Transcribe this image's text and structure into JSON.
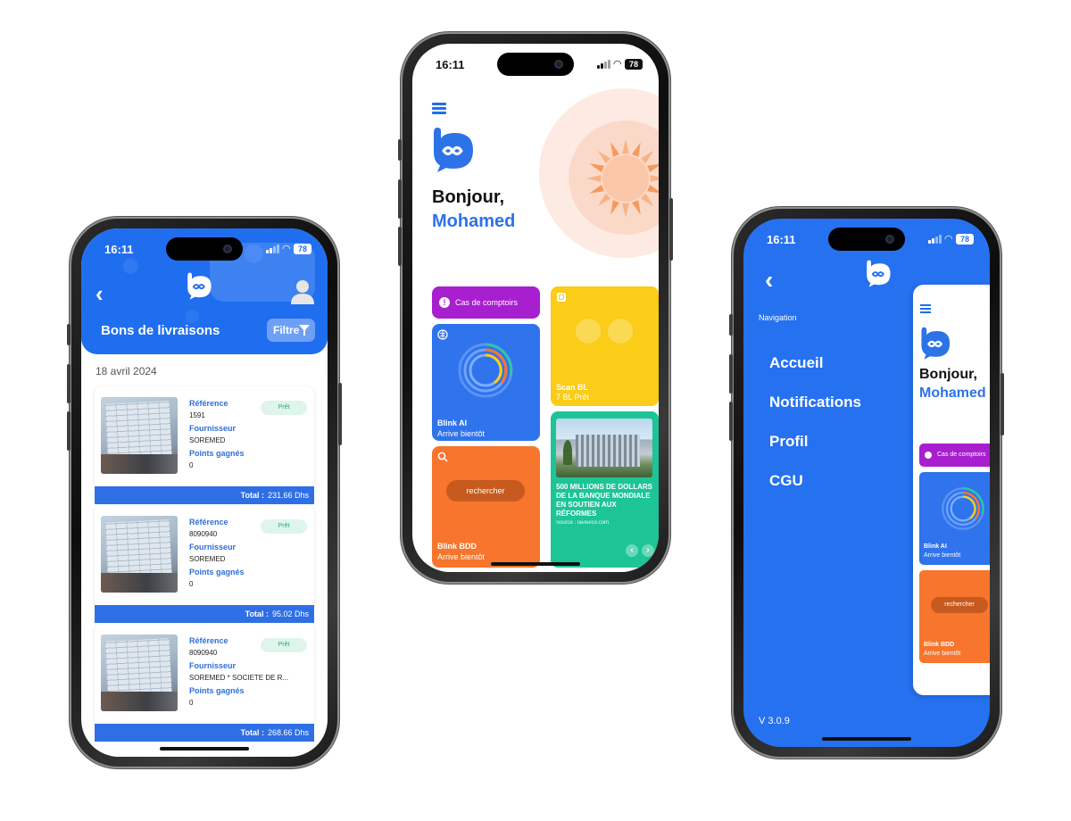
{
  "status": {
    "time": "16:11",
    "battery": "78"
  },
  "colors": {
    "primary": "#1f6ef0",
    "purple": "#a81fcf",
    "orange": "#f7752d",
    "yellow": "#fbcc18",
    "green": "#1dc496"
  },
  "deliveries": {
    "title": "Bons de livraisons",
    "filter_label": "Filtre",
    "date": "18 avril 2024",
    "labels": {
      "reference": "Référence",
      "supplier": "Fournisseur",
      "points": "Points gagnés",
      "total": "Total :"
    },
    "items": [
      {
        "reference": "1591",
        "supplier": "SOREMED",
        "points": "0",
        "status": "Prêt",
        "total": "231.66 Dhs"
      },
      {
        "reference": "8090940",
        "supplier": "SOREMED",
        "points": "0",
        "status": "Prêt",
        "total": "95.02 Dhs"
      },
      {
        "reference": "8090940",
        "supplier": "SOREMED * SOCIETE DE R...",
        "points": "0",
        "status": "Prêt",
        "total": "268.66 Dhs"
      }
    ]
  },
  "home": {
    "greeting": "Bonjour,",
    "user_name": "Mohamed",
    "tiles": {
      "cas": {
        "label": "Cas de comptoirs"
      },
      "ai": {
        "title": "Blink AI",
        "subtitle": "Arrive bientôt"
      },
      "bdd": {
        "title": "Blink BDD",
        "subtitle": "Arrive bientôt",
        "button": "rechercher"
      },
      "scan": {
        "title": "Scan BL",
        "subtitle": "7 BL Prêt"
      },
      "news": {
        "headline": "500 MILLIONS DE DOLLARS DE LA BANQUE MONDIALE EN SOUTIEN AUX RÉFORMES",
        "source": "Source : lavieeco.com",
        "prev": "‹",
        "next": "›"
      }
    }
  },
  "menu": {
    "nav_label": "Navigation",
    "items": [
      {
        "label": "Accueil"
      },
      {
        "label": "Notifications"
      },
      {
        "label": "Profil"
      },
      {
        "label": "CGU"
      }
    ],
    "version": "V 3.0.9",
    "preview": {
      "greeting": "Bonjour,",
      "user_name": "Mohamed",
      "cas": "Cas de comptoirs",
      "ai_title": "Blink AI",
      "ai_sub": "Arrive bientôt",
      "bdd_btn": "rechercher",
      "bdd_title": "Blink BDD",
      "bdd_sub": "Arrive bientôt"
    }
  }
}
